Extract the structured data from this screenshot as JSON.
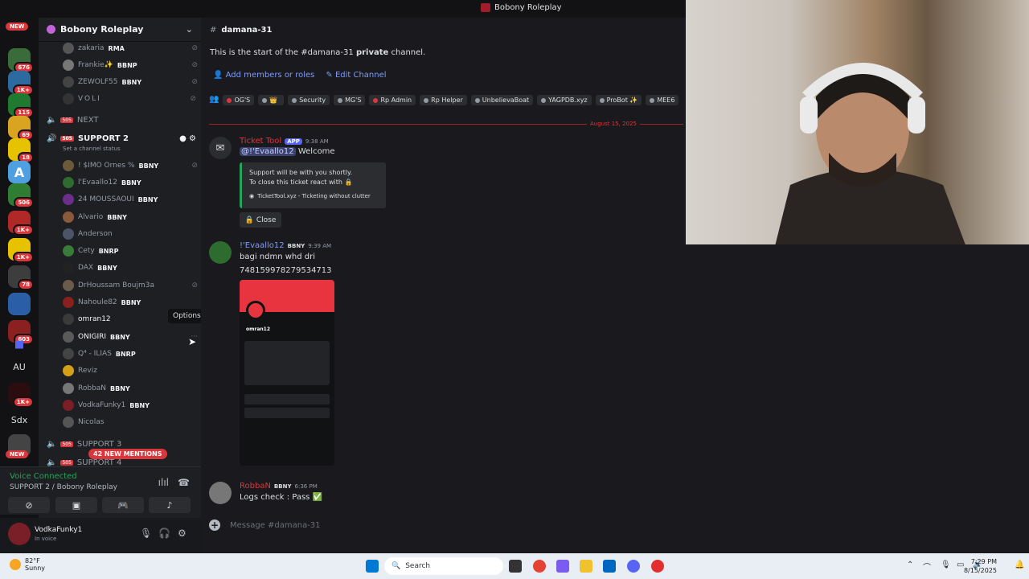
{
  "window": {
    "title": "Bobony Roleplay"
  },
  "rail": {
    "new_top": "NEW",
    "new_bottom": "NEW",
    "badges": [
      "676",
      "1K+",
      "115",
      "69",
      "18",
      "506",
      "1K+",
      "1K+",
      "78",
      "603",
      "1K+"
    ],
    "text_servers": [
      "AU",
      "Sdx"
    ]
  },
  "guild": {
    "name": "Bobony Roleplay"
  },
  "sidebar": {
    "top_users": [
      {
        "name": "zakaria",
        "badge": "RMA"
      },
      {
        "name": "Frankie✨",
        "badge": "BBNP"
      },
      {
        "name": "ZEWOLF55",
        "badge": "BBNY"
      },
      {
        "name": "VOLI",
        "badge": ""
      }
    ],
    "channel_next": "NEXT",
    "channel_support2": "SUPPORT 2",
    "set_status": "Set a channel status",
    "voice_users": [
      {
        "name": "! $IMO Ornes %",
        "badge": "BBNY"
      },
      {
        "name": "l'Evaallo12",
        "badge": "BBNY"
      },
      {
        "name": "24 MOUSSAOUI",
        "badge": "BBNY"
      },
      {
        "name": "Alvario",
        "badge": "BBNY"
      },
      {
        "name": "Anderson",
        "badge": ""
      },
      {
        "name": "Cety",
        "badge": "BNRP"
      },
      {
        "name": "DAX",
        "badge": "BBNY"
      },
      {
        "name": "DrHoussam Boujm3a",
        "badge": ""
      },
      {
        "name": "Nahoule82",
        "badge": "BBNY"
      },
      {
        "name": "omran12",
        "badge": ""
      },
      {
        "name": "ONIGIRI",
        "badge": "BBNY"
      },
      {
        "name": "Q⁴ - ILIAS",
        "badge": "BNRP"
      },
      {
        "name": "Reviz",
        "badge": ""
      },
      {
        "name": "RobbaN",
        "badge": "BBNY"
      },
      {
        "name": "VodkaFunky1",
        "badge": "BBNY"
      },
      {
        "name": "Nicolas",
        "badge": ""
      }
    ],
    "channel_support3": "SUPPORT 3",
    "channel_support4": "SUPPORT 4",
    "mentions": "42 NEW MENTIONS",
    "tooltip": "Options"
  },
  "voice": {
    "status": "Voice Connected",
    "location": "SUPPORT 2 / Bobony Roleplay"
  },
  "user": {
    "name": "VodkaFunky1",
    "status": "In voice"
  },
  "channel": {
    "name": "damana-31",
    "start_prefix": "This is the start of the #damana-31 ",
    "start_bold": "private",
    "start_suffix": " channel.",
    "add_members": "Add members or roles",
    "edit_channel": "Edit Channel",
    "roles": [
      "OG'S",
      "",
      "Security",
      "MG'S",
      "Rp Admin",
      "Rp Helper",
      "UnbelievaBoat",
      "YAGPDB.xyz",
      "ProBot ✨",
      "MEE6"
    ],
    "date_divider": "August 15, 2025",
    "composer_placeholder": "Message #damana-31"
  },
  "messages": {
    "m1": {
      "author": "Ticket Tool",
      "app": "APP",
      "time": "9:38 AM",
      "mention": "@!'Evaallo12",
      "text": " Welcome",
      "embed_line1": "Support will be with you shortly.",
      "embed_line2": "To close this ticket react with 🔒",
      "embed_footer": "TicketTool.xyz - Ticketing without clutter",
      "button": "Close"
    },
    "m2": {
      "author": "!'Evaallo12",
      "badge": "BBNY",
      "time": "9:39 AM",
      "line1": "bagi ndmn whd dri",
      "line2": "748159978279534713",
      "shot_name": "omran12"
    },
    "m3": {
      "author": "RobbaN",
      "badge": "BBNY",
      "time": "6:36 PM",
      "text": "Logs check : Pass ✅"
    }
  },
  "taskbar": {
    "temp": "82°F",
    "weather": "Sunny",
    "search": "Search",
    "time": "7:29 PM",
    "date": "8/15/2025"
  },
  "colors": {
    "accent": "#5865f2",
    "danger": "#da373c",
    "online": "#23a55a",
    "link": "#7e9bf5"
  }
}
